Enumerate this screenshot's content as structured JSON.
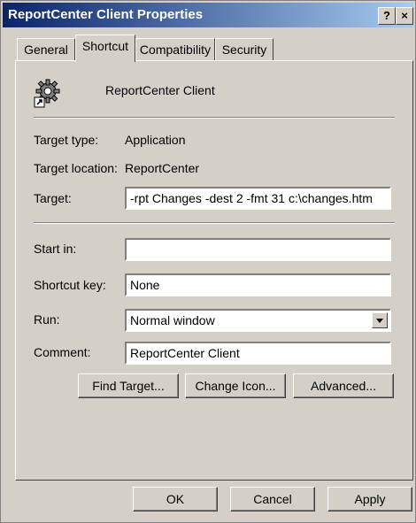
{
  "window": {
    "title": "ReportCenter Client Properties",
    "help_button": "?",
    "close_button": "×"
  },
  "tabs": [
    {
      "label": "General"
    },
    {
      "label": "Shortcut"
    },
    {
      "label": "Compatibility"
    },
    {
      "label": "Security"
    }
  ],
  "shortcut": {
    "name": "ReportCenter Client",
    "target_type_label": "Target type:",
    "target_type_value": "Application",
    "target_location_label": "Target location:",
    "target_location_value": "ReportCenter",
    "target_label": "Target:",
    "target_value": "-rpt Changes -dest 2 -fmt 31 c:\\changes.htm",
    "start_in_label": "Start in:",
    "start_in_value": "",
    "shortcut_key_label": "Shortcut key:",
    "shortcut_key_value": "None",
    "run_label": "Run:",
    "run_value": "Normal window",
    "comment_label": "Comment:",
    "comment_value": "ReportCenter Client",
    "find_target_label": "Find Target...",
    "change_icon_label": "Change Icon...",
    "advanced_label": "Advanced..."
  },
  "footer": {
    "ok_label": "OK",
    "cancel_label": "Cancel",
    "apply_label": "Apply"
  }
}
